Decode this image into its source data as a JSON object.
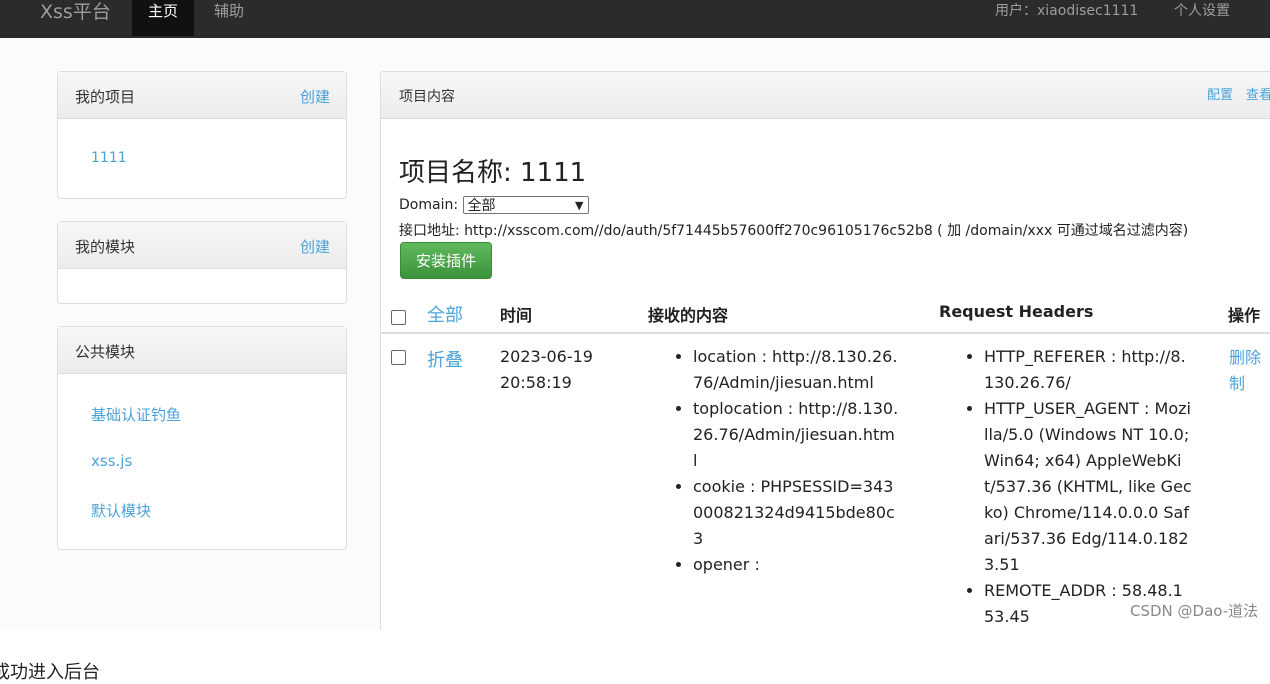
{
  "topbar": {
    "brand": "Xss平台",
    "nav": [
      "主页",
      "辅助"
    ],
    "user_label": "用户：xiaodisec1111",
    "settings_label": "个人设置"
  },
  "sidebar": {
    "projects": {
      "title": "我的项目",
      "action": "创建",
      "items": [
        "1111"
      ]
    },
    "modules": {
      "title": "我的模块",
      "action": "创建"
    },
    "public": {
      "title": "公共模块",
      "items": [
        "基础认证钓鱼",
        "xss.js",
        "默认模块"
      ]
    }
  },
  "main": {
    "header_title": "项目内容",
    "config_link": "配置",
    "view_link": "查看",
    "project_name_label": "项目名称: 1111",
    "domain_label": "Domain:",
    "domain_value": "全部",
    "api_text": "接口地址: http://xsscom.com//do/auth/5f71445b57600ff270c96105176c52b8 ( 加 /domain/xxx 可通过域名过滤内容)",
    "install_button": "安装插件",
    "table": {
      "col_all": "全部",
      "col_time": "时间",
      "col_content": "接收的内容",
      "col_headers": "Request Headers",
      "col_ops": "操作",
      "row": {
        "fold": "折叠",
        "time": "2023-06-19\n20:58:19",
        "content": [
          "location : http://8.130.26.76/Admin/jiesuan.html",
          "toplocation : http://8.130.26.76/Admin/jiesuan.html",
          "cookie : PHPSESSID=343000821324d9415bde80c3",
          "opener :"
        ],
        "headers": [
          "HTTP_REFERER : http://8.130.26.76/",
          "HTTP_USER_AGENT : Mozilla/5.0 (Windows NT 10.0; Win64; x64) AppleWebKit/537.36 (KHTML, like Gecko) Chrome/114.0.0.0 Safari/537.36 Edg/114.0.1823.51",
          "REMOTE_ADDR : 58.48.153.45"
        ],
        "ops": "删除\n制"
      }
    }
  },
  "watermark": "CSDN @Dao-道法",
  "bottom_text": "成功进入后台"
}
